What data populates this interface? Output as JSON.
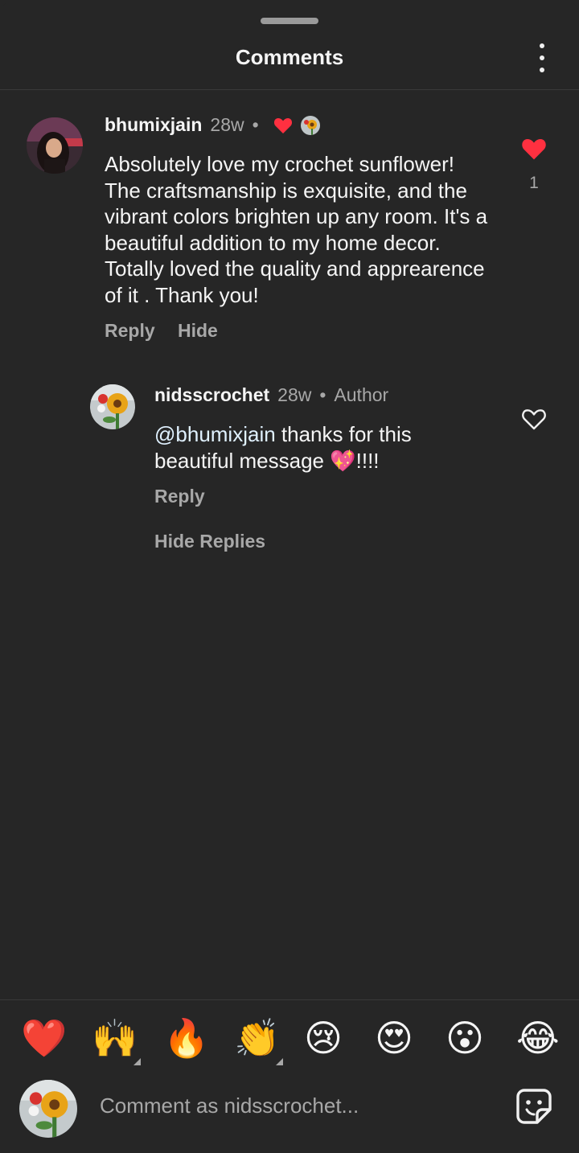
{
  "header": {
    "title": "Comments"
  },
  "comments": [
    {
      "username": "bhumixjain",
      "age": "28w",
      "text": "Absolutely love my crochet sunflower! The craftsmanship is exquisite, and the vibrant colors brighten up any room. It's a beautiful addition to my home decor. Totally loved the quality and apprearence of it . Thank you!",
      "like_count": "1",
      "reply_label": "Reply",
      "hide_label": "Hide"
    }
  ],
  "reply": {
    "username": "nidsscrochet",
    "age": "28w",
    "badge": "Author",
    "mention": "@bhumixjain",
    "text": " thanks for this beautiful message 💖!!!!",
    "reply_label": "Reply"
  },
  "hide_replies_label": "Hide Replies",
  "reactions": [
    "❤️",
    "🙌",
    "🔥",
    "👏",
    "😢",
    "😍",
    "😮",
    "😂"
  ],
  "composer": {
    "placeholder": "Comment as nidsscrochet..."
  },
  "colors": {
    "background": "#262626",
    "like_red": "#ff3040",
    "secondary_text": "#a8a8a8"
  }
}
